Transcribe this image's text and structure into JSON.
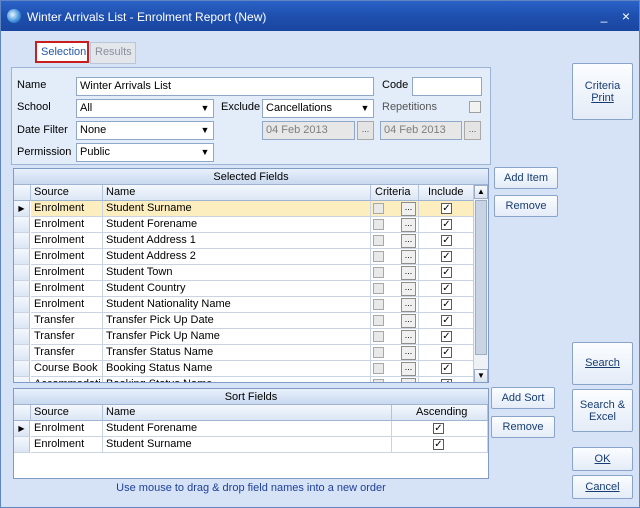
{
  "window": {
    "title": "Winter Arrivals List - Enrolment Report (New)",
    "minimize_label": "_",
    "close_label": "×"
  },
  "tabs": [
    {
      "label": "Selection",
      "active": true
    },
    {
      "label": "Results",
      "active": false
    }
  ],
  "form": {
    "name_label": "Name",
    "name_value": "Winter Arrivals List",
    "code_label": "Code",
    "code_value": "",
    "school_label": "School",
    "school_value": "All",
    "exclude_label": "Exclude",
    "exclude_value": "Cancellations",
    "repetitions_label": "Repetitions",
    "date_filter_label": "Date Filter",
    "date_filter_value": "None",
    "date_from": "04 Feb 2013",
    "date_to": "04 Feb 2013",
    "ellipsis": "...",
    "permission_label": "Permission",
    "permission_value": "Public"
  },
  "selected_fields": {
    "caption": "Selected Fields",
    "columns": [
      "Source",
      "Name",
      "Criteria",
      "Include"
    ],
    "rows": [
      {
        "source": "Enrolment",
        "name": "Student Surname"
      },
      {
        "source": "Enrolment",
        "name": "Student Forename"
      },
      {
        "source": "Enrolment",
        "name": "Student Address 1"
      },
      {
        "source": "Enrolment",
        "name": "Student Address 2"
      },
      {
        "source": "Enrolment",
        "name": "Student Town"
      },
      {
        "source": "Enrolment",
        "name": "Student Country"
      },
      {
        "source": "Enrolment",
        "name": "Student Nationality Name"
      },
      {
        "source": "Transfer",
        "name": "Transfer Pick Up Date"
      },
      {
        "source": "Transfer",
        "name": "Transfer Pick Up Name"
      },
      {
        "source": "Transfer",
        "name": "Transfer Status Name"
      },
      {
        "source": "Course Book",
        "name": "Booking Status Name"
      },
      {
        "source": "Accommodati",
        "name": "Booking Status Name"
      }
    ]
  },
  "sort_fields": {
    "caption": "Sort Fields",
    "columns": [
      "Source",
      "Name",
      "Ascending"
    ],
    "rows": [
      {
        "source": "Enrolment",
        "name": "Student Forename"
      },
      {
        "source": "Enrolment",
        "name": "Student Surname"
      }
    ]
  },
  "buttons": {
    "add_item": "Add Item",
    "remove": "Remove",
    "add_sort": "Add Sort",
    "remove_sort": "Remove",
    "criteria_print_1": "Criteria",
    "criteria_print_2": "Print",
    "search": "Search",
    "search_excel_1": "Search &",
    "search_excel_2": "Excel",
    "ok": "OK",
    "cancel": "Cancel"
  },
  "status_text": "Use mouse to drag & drop field names into a new order",
  "icons": {
    "row_pointer": "▶",
    "check": "✓",
    "combo": "▼",
    "scroll_up": "▲",
    "scroll_down": "▼"
  }
}
